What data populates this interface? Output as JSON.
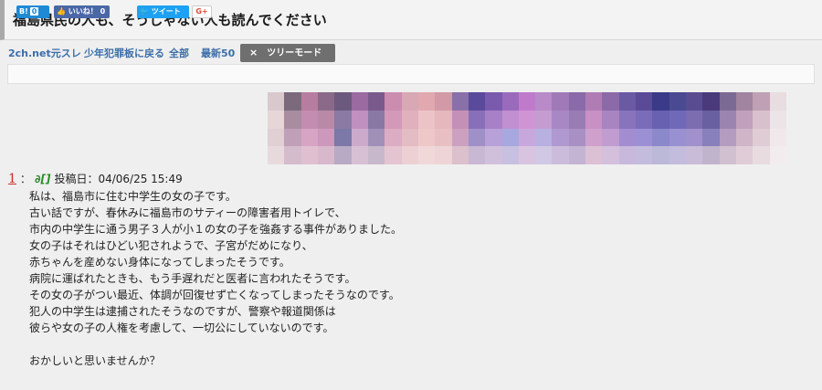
{
  "thread": {
    "title": "福島県民の人も、そうじゃない人も読んでください"
  },
  "nav": {
    "links": [
      "2ch.net元スレ",
      "少年犯罪板に戻る",
      "全部",
      "最新50"
    ],
    "tree_mode": "ツリーモード",
    "tree_close": "×"
  },
  "social": {
    "hatena_label": "B!",
    "hatena_count": "0",
    "fb_label": "いいね！",
    "fb_count": "0",
    "tweet_label": "ツイート",
    "gplus_label": "G+"
  },
  "post": {
    "number": "1",
    "name": "∂[]",
    "date_label": "投稿日：04/06/25 15:49",
    "lines": [
      "私は、福島市に住む中学生の女の子です。",
      "古い話ですが、春休みに福島市のサティーの障害者用トイレで、",
      "市内の中学生に通う男子３人が小１の女の子を強姦する事件がありました。",
      "女の子はそれはひどい犯されようで、子宮がだめになり、",
      "赤ちゃんを産めない身体になってしまったそうです。",
      "病院に運ばれたときも、もう手遅れだと医者に言われたそうです。",
      "その女の子がつい最近、体調が回復せず亡くなってしまったそうなのです。",
      "犯人の中学生は逮捕されたそうなのですが、警察や報道関係は",
      "彼らや女の子の人権を考慮して、一切公にしていないのです。",
      "",
      "おかしいと思いませんか？"
    ]
  },
  "colors": {
    "link": "#3b6ea8",
    "post_number": "#cc2a2a",
    "post_name": "#2a8a2a",
    "tree_button": "#6f6f6f",
    "mosaic": [
      "#d9c9cc",
      "#7a6a7c",
      "#b77da0",
      "#8a6a88",
      "#6c5a7e",
      "#9a6aa0",
      "#7a5a8c",
      "#cc8cb0",
      "#d8a8b4",
      "#e2a8b0",
      "#d29aa6",
      "#8a70a8",
      "#5a4a9c",
      "#7a5aac",
      "#9a6abc",
      "#c07acc",
      "#b88ac8",
      "#a07ab8",
      "#8a6aa8",
      "#b07cb4",
      "#8c6aa8",
      "#6a5aa4",
      "#5a4a98",
      "#3a3a88",
      "#4a4a92",
      "#5a4c90",
      "#4a3a7c",
      "#7a6a94",
      "#a084a0",
      "#c0a0b4",
      "#e8dde0",
      "#e6d6d8",
      "#a88ca0",
      "#c48cb0",
      "#b88aa8",
      "#8a7aa4",
      "#c090c0",
      "#8a78a4",
      "#d498b8",
      "#e0b0bc",
      "#ecc4c8",
      "#e4b8bc",
      "#c490b8",
      "#8870b8",
      "#a880c8",
      "#c090d0",
      "#d094d4",
      "#c49cd0",
      "#a888c4",
      "#9a7cb4",
      "#c890c4",
      "#a884c0",
      "#8874bc",
      "#7a6cb8",
      "#6860b0",
      "#7068b8",
      "#7c6cb0",
      "#6860a0",
      "#9c84b0",
      "#c0a0bc",
      "#d8c0cc",
      "#ece4e6",
      "#e0d0d4",
      "#c0a0b8",
      "#d8a4c4",
      "#cc98bc",
      "#7c78a8",
      "#ccaacc",
      "#a090b8",
      "#dcacc4",
      "#e4bcc4",
      "#eec8c8",
      "#e8c0c4",
      "#cca0c0",
      "#a090c8",
      "#b8a0d8",
      "#a8a8e0",
      "#c8a8dc",
      "#b8b0e0",
      "#b098d0",
      "#a890c4",
      "#d0a0cc",
      "#c09cd0",
      "#a48cd0",
      "#9c90d4",
      "#8c88cc",
      "#9890d0",
      "#a090cc",
      "#8880bc",
      "#b49cc0",
      "#d0b4c8",
      "#e0ccd4",
      "#f0e8ea",
      "#e8dadc",
      "#d4bccc",
      "#e0c0d0",
      "#d8b8cc",
      "#b8aac4",
      "#d8c0d4",
      "#c8b8cc",
      "#e4c4d0",
      "#ecd0d4",
      "#f0d8d8",
      "#eed4d6",
      "#dcc0cc",
      "#c8b8d4",
      "#d0c0dc",
      "#c8c0e0",
      "#d8c4e0",
      "#d0c8e4",
      "#ccbcdc",
      "#c4b4d4",
      "#dcc0d4",
      "#d4c0dc",
      "#c8b8dc",
      "#c4bcdc",
      "#bcb8d8",
      "#c4bcdc",
      "#c8bcd8",
      "#c0b4cc",
      "#d0c0d0",
      "#e0ccd6",
      "#e8dce0",
      "#f2ecee"
    ]
  }
}
